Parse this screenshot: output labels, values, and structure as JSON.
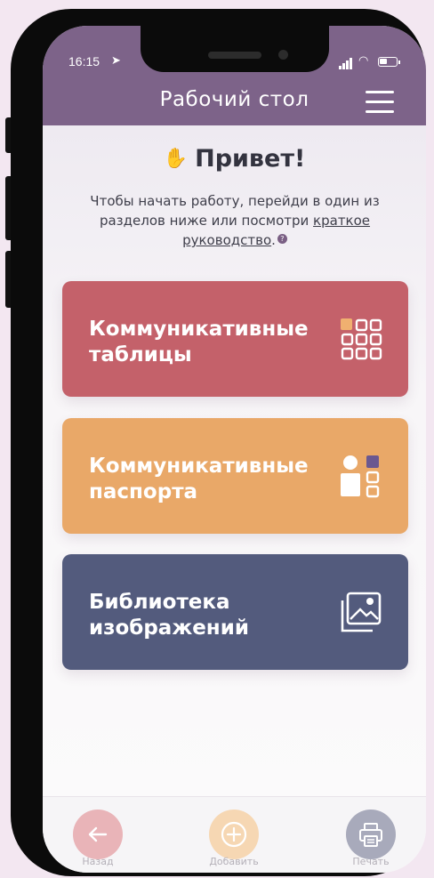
{
  "status_bar": {
    "time": "16:15"
  },
  "header": {
    "title": "Рабочий стол"
  },
  "greeting": {
    "title": "Привет!"
  },
  "intro": {
    "text": "Чтобы начать работу, перейди в один из разделов ниже или посмотри",
    "link": "краткое руководство",
    "suffix": "."
  },
  "cards": [
    {
      "label_line1": "Коммуникативные",
      "label_line2": "таблицы",
      "icon": "grid-icon",
      "color": "#c4616a"
    },
    {
      "label_line1": "Коммуникативные",
      "label_line2": "паспорта",
      "icon": "passport-icon",
      "color": "#e9a868"
    },
    {
      "label_line1": "Библиотека",
      "label_line2": "изображений",
      "icon": "image-library-icon",
      "color": "#535b7d"
    }
  ],
  "bottom_bar": {
    "back_label": "Назад",
    "add_label": "Добавить",
    "print_label": "Печать"
  },
  "colors": {
    "header": "#7d6389",
    "back": "#e9b4b8",
    "add": "#f6d7b3",
    "print": "#a8aabb"
  }
}
